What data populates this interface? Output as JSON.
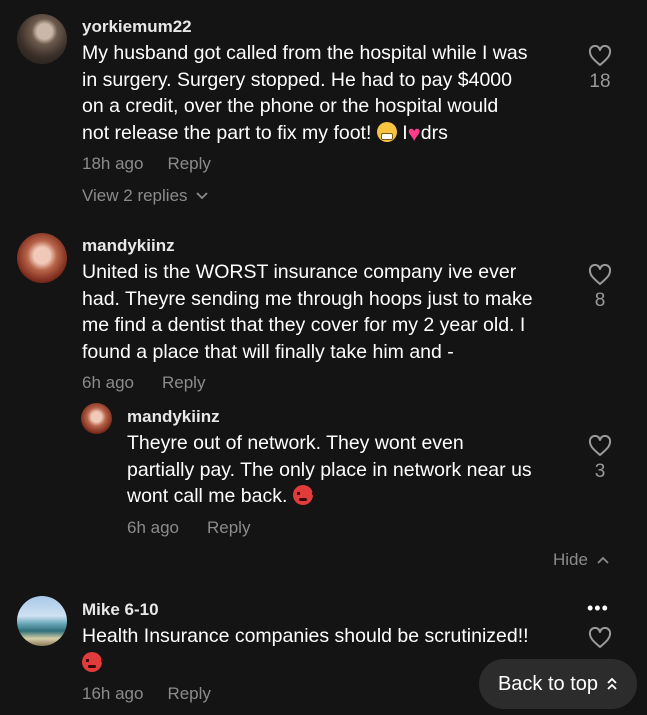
{
  "comments": [
    {
      "user": "yorkiemum22",
      "text_lines": [
        "My husband got called from the hospital while I was",
        "in surgery. Surgery stopped. He had to pay $4000",
        "on a credit, over the phone or the hospital would",
        "not release the part to fix my foot!"
      ],
      "text_tail_1": "I",
      "text_tail_2": "drs",
      "time": "18h ago",
      "reply_label": "Reply",
      "likes": "18",
      "view_replies": "View 2 replies"
    },
    {
      "user": "mandykiinz",
      "text_lines": [
        "United is the WORST insurance company ive ever",
        "had. Theyre sending me through hoops just to make",
        "me find a dentist that they cover for my 2 year old. I",
        "found a place that will finally take him and -"
      ],
      "time": "6h ago",
      "reply_label": "Reply",
      "likes": "8"
    },
    {
      "user": "mandykiinz",
      "text_lines": [
        "Theyre out of network. They wont even",
        "partially pay. The only place in network near us",
        "wont call me back."
      ],
      "time": "6h ago",
      "reply_label": "Reply",
      "likes": "3"
    },
    {
      "user": "Mike 6-10",
      "text_lines": [
        "Health Insurance companies should be scrutinized!!"
      ],
      "time": "16h ago",
      "reply_label": "Reply",
      "likes": ""
    }
  ],
  "hide_label": "Hide",
  "back_to_top_label": "Back to top",
  "icons": {
    "like": "heart-outline-icon",
    "chevron_down": "chevron-down-icon",
    "chevron_up": "chevron-up-icon",
    "more": "more-dots-icon",
    "back_to_top": "double-chevron-up-icon"
  }
}
